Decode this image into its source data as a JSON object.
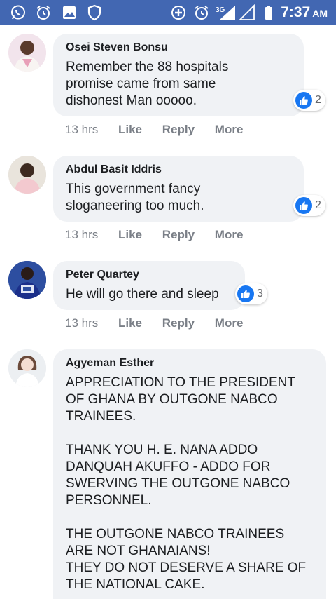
{
  "status_bar": {
    "left_icons": [
      "whatsapp-icon",
      "alarm-icon",
      "gallery-icon",
      "shield-icon"
    ],
    "right_icons": [
      "data-saver-icon",
      "alarm-icon",
      "signal-3g-icon",
      "signal-empty-icon",
      "battery-icon"
    ],
    "network_label": "3G",
    "time": "7:37",
    "ampm": "AM"
  },
  "comments": [
    {
      "author": "Osei Steven Bonsu",
      "text": "Remember the 88 hospitals\npromise came from same\ndishonest Man ooooo.",
      "reactions": "2",
      "time": "13 hrs",
      "like": "Like",
      "reply": "Reply",
      "more": "More"
    },
    {
      "author": "Abdul Basit Iddris",
      "text": "This government fancy\nsloganeering too much.",
      "reactions": "2",
      "time": "13 hrs",
      "like": "Like",
      "reply": "Reply",
      "more": "More"
    },
    {
      "author": "Peter Quartey",
      "text": "He will go there and sleep",
      "reactions": "3",
      "time": "13 hrs",
      "like": "Like",
      "reply": "Reply",
      "more": "More"
    },
    {
      "author": "Agyeman Esther",
      "text": "APPRECIATION TO THE PRESIDENT\nOF GHANA BY OUTGONE NABCO\nTRAINEES.\n\nTHANK YOU H. E. NANA ADDO\nDANQUAH AKUFFO - ADDO FOR\nSWERVING THE OUTGONE NABCO\nPERSONNEL.\n\nTHE OUTGONE NABCO TRAINEES\nARE NOT GHANAIANS!\nTHEY DO NOT DESERVE A SHARE OF\nTHE NATIONAL CAKE."
    }
  ],
  "colors": {
    "status_bar": "#4267b2",
    "bubble": "#f0f2f5",
    "like_blue": "#1877f2",
    "meta_gray": "#7a7f87"
  }
}
